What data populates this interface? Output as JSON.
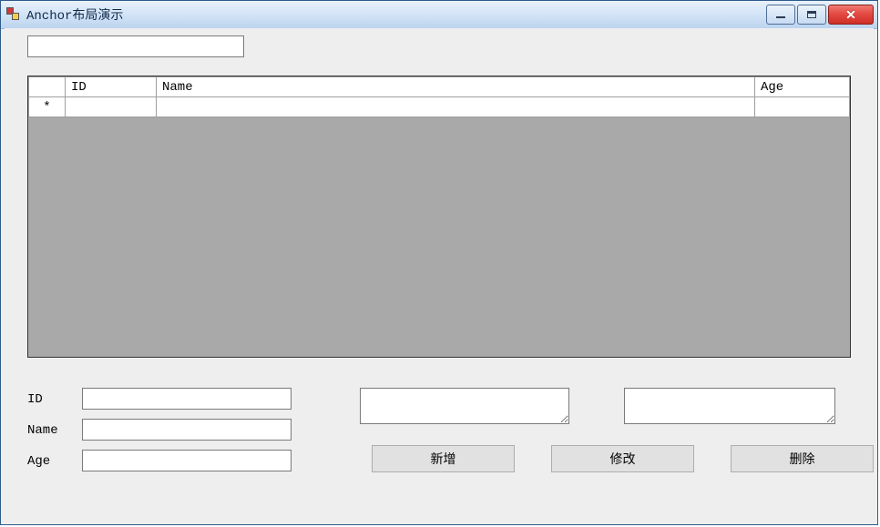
{
  "window": {
    "title": "Anchor布局演示"
  },
  "search": {
    "value": ""
  },
  "grid": {
    "columns": [
      "ID",
      "Name",
      "Age"
    ],
    "new_row_marker": "*",
    "rows": [
      {
        "id": "",
        "name": "",
        "age": ""
      }
    ]
  },
  "form": {
    "labels": {
      "id": "ID",
      "name": "Name",
      "age": "Age"
    },
    "values": {
      "id": "",
      "name": "",
      "age": ""
    },
    "extra_a": "",
    "extra_b": ""
  },
  "buttons": {
    "add": "新增",
    "edit": "修改",
    "delete": "删除"
  }
}
